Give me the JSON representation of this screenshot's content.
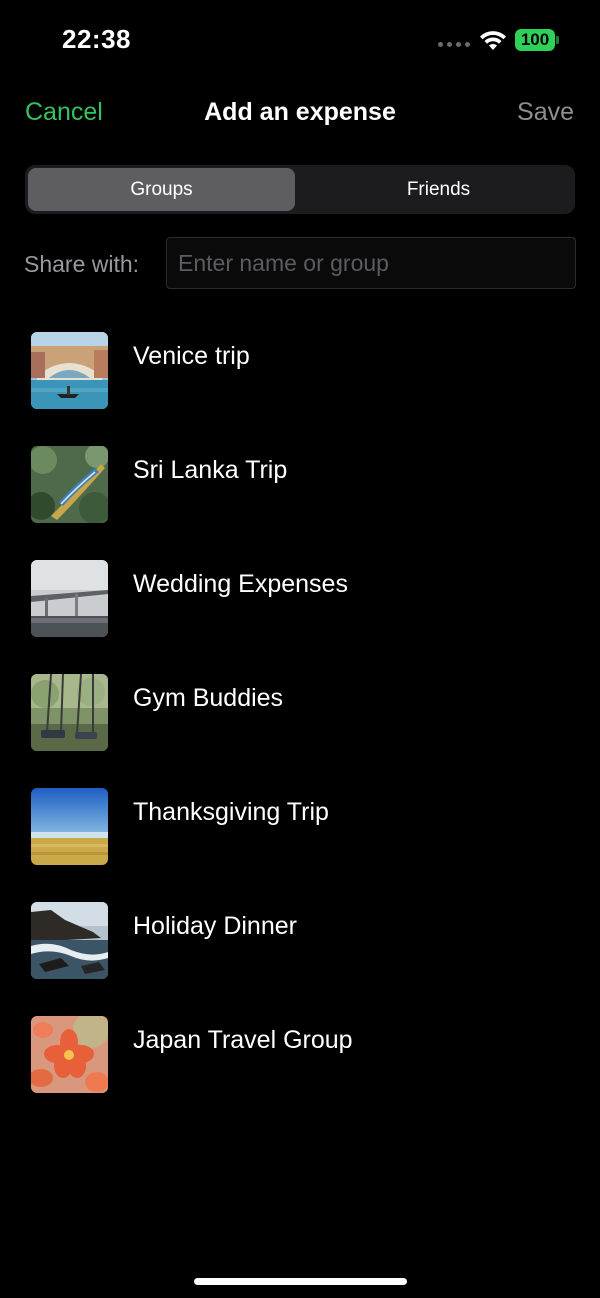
{
  "status_bar": {
    "time": "22:38",
    "battery": "100",
    "icons": [
      "signal-dots-icon",
      "wifi-icon",
      "battery-icon"
    ],
    "battery_color": "#30d158"
  },
  "nav": {
    "cancel_label": "Cancel",
    "title": "Add an expense",
    "save_label": "Save",
    "cancel_color": "#36c15e"
  },
  "segments": {
    "groups_label": "Groups",
    "friends_label": "Friends",
    "selected": "Groups"
  },
  "share": {
    "label": "Share with:",
    "placeholder": "Enter name or group",
    "value": ""
  },
  "groups": [
    {
      "name": "Venice trip",
      "thumbnail": "venice-canal-photo"
    },
    {
      "name": "Sri Lanka Trip",
      "thumbnail": "train-in-forest-photo"
    },
    {
      "name": "Wedding Expenses",
      "thumbnail": "foggy-bridge-photo"
    },
    {
      "name": "Gym Buddies",
      "thumbnail": "swings-photo"
    },
    {
      "name": "Thanksgiving Trip",
      "thumbnail": "field-and-sky-photo"
    },
    {
      "name": "Holiday Dinner",
      "thumbnail": "rocky-coast-photo"
    },
    {
      "name": "Japan Travel Group",
      "thumbnail": "orange-flowers-photo"
    }
  ]
}
